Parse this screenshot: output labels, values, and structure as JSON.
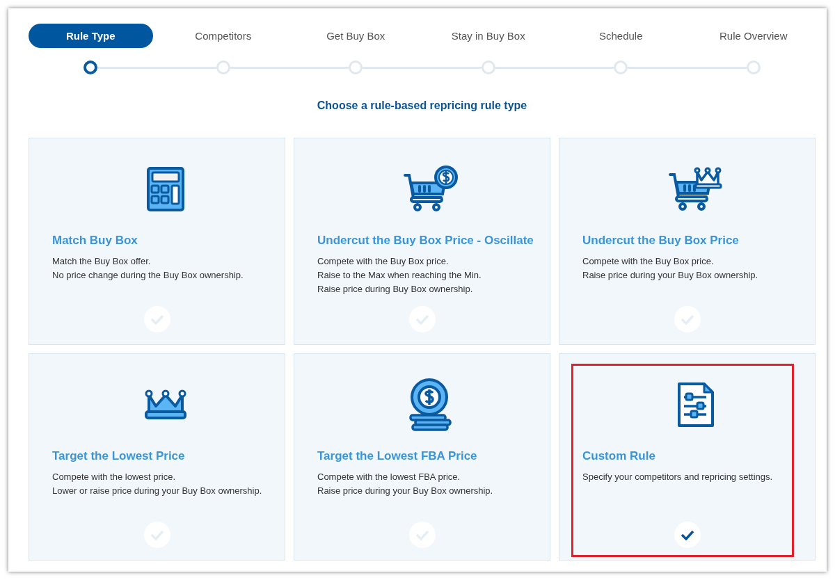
{
  "steps": [
    {
      "label": "Rule Type",
      "selected": true
    },
    {
      "label": "Competitors",
      "selected": false
    },
    {
      "label": "Get Buy Box",
      "selected": false
    },
    {
      "label": "Stay in Buy Box",
      "selected": false
    },
    {
      "label": "Schedule",
      "selected": false
    },
    {
      "label": "Rule Overview",
      "selected": false
    }
  ],
  "heading": "Choose a rule-based repricing rule type",
  "cards": [
    {
      "kind": "calculator",
      "title": "Match Buy Box",
      "lines": [
        "Match the Buy Box offer.",
        "No price change during the Buy Box ownership."
      ],
      "selected": false,
      "highlighted": false
    },
    {
      "kind": "cart_coin",
      "title": "Undercut the Buy Box Price - Oscillate",
      "lines": [
        "Compete with the Buy Box price.",
        "Raise to the Max when reaching the Min.",
        "Raise price during Buy Box ownership."
      ],
      "selected": false,
      "highlighted": false
    },
    {
      "kind": "cart_crown",
      "title": "Undercut the Buy Box Price",
      "lines": [
        "Compete with the Buy Box price.",
        "Raise price during your Buy Box ownership."
      ],
      "selected": false,
      "highlighted": false
    },
    {
      "kind": "crown",
      "title": "Target the Lowest Price",
      "lines": [
        "Compete with the lowest price.",
        "Lower or raise price during your Buy Box ownership."
      ],
      "selected": false,
      "highlighted": false
    },
    {
      "kind": "coins",
      "title": "Target the Lowest FBA Price",
      "lines": [
        "Compete with the lowest FBA price.",
        "Raise price during your Buy Box ownership."
      ],
      "selected": false,
      "highlighted": false
    },
    {
      "kind": "document_sliders",
      "title": "Custom Rule",
      "lines": [
        "Specify your competitors and repricing settings."
      ],
      "selected": true,
      "highlighted": true
    }
  ]
}
